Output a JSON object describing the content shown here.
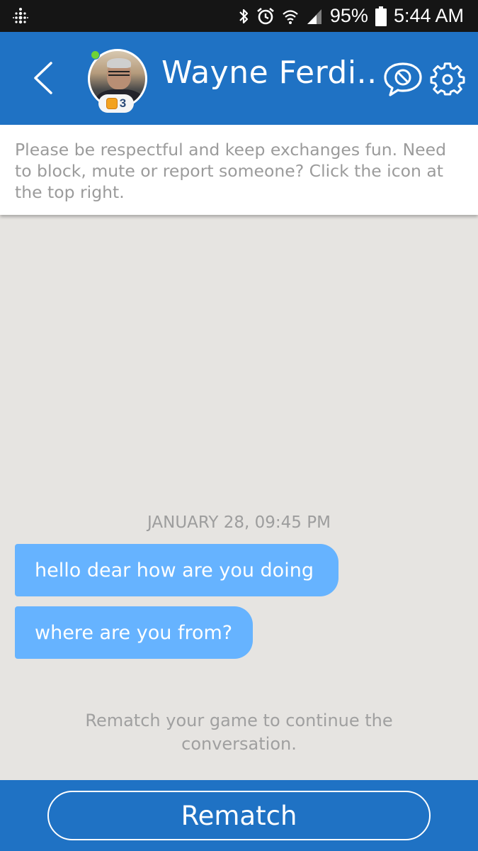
{
  "status_bar": {
    "battery": "95%",
    "time": "5:44 AM",
    "icons": [
      "fitbit-icon",
      "bluetooth-icon",
      "alarm-icon",
      "wifi-icon",
      "signal-icon",
      "battery-icon"
    ]
  },
  "header": {
    "back_icon": "chevron-left-icon",
    "contact_name": "Wayne Ferdi..",
    "level": "3",
    "online": true,
    "block_icon": "chat-block-icon",
    "settings_icon": "gear-icon"
  },
  "notice": {
    "text": "Please be respectful and keep exchanges fun. Need to block, mute or report someone? Click the icon at the top right."
  },
  "conversation": {
    "timestamp": "JANUARY 28, 09:45 PM",
    "messages": [
      {
        "text": "hello dear how are you doing"
      },
      {
        "text": "where are you from?"
      }
    ],
    "rematch_hint": "Rematch your game to continue the conversation."
  },
  "footer": {
    "rematch_label": "Rematch"
  },
  "colors": {
    "header_blue": "#1f72c4",
    "bubble_blue": "#66b3ff",
    "background": "#e6e4e1",
    "online_green": "#6fd235"
  }
}
